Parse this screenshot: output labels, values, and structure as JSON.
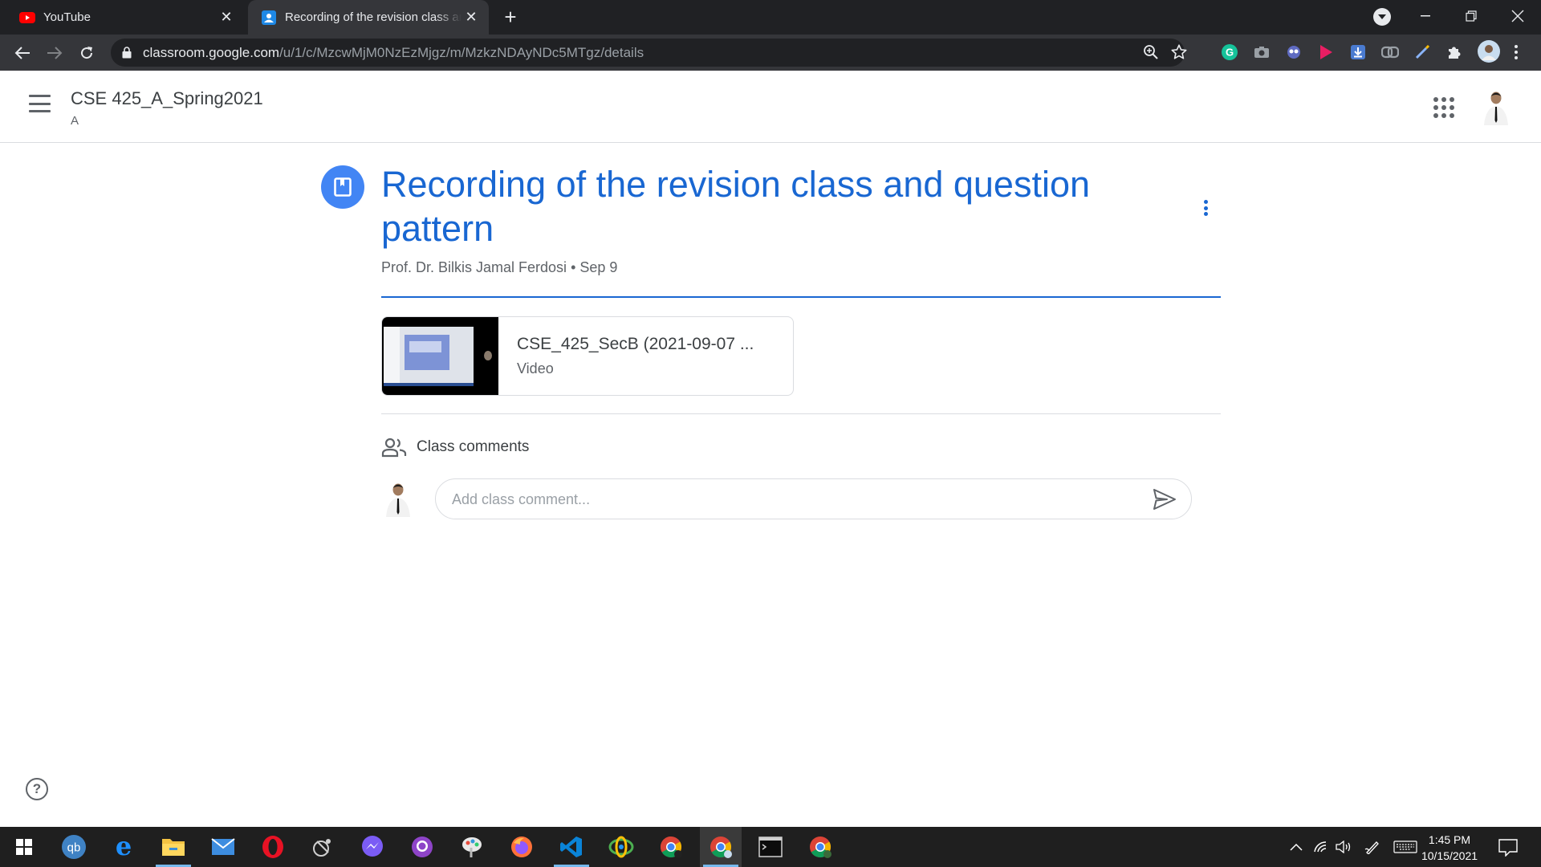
{
  "browser": {
    "tabs": [
      {
        "title": "YouTube",
        "icon": "youtube-icon",
        "active": false
      },
      {
        "title": "Recording of the revision class and question pattern",
        "icon": "classroom-icon",
        "active": true
      }
    ],
    "url_host": "classroom.google.com",
    "url_path": "/u/1/c/MzcwMjM0NzEzMjgz/m/MzkzNDAyNDc5MTgz/details",
    "extensions": [
      "grammarly-icon",
      "camera-icon",
      "extension-icon",
      "play-icon",
      "download-icon",
      "link-icon",
      "pen-icon",
      "puzzle-icon",
      "profile-avatar"
    ]
  },
  "header": {
    "class_title": "CSE 425_A_Spring2021",
    "class_section": "A"
  },
  "material": {
    "icon": "book-icon",
    "title": "Recording of the revision class and question pattern",
    "author": "Prof. Dr. Bilkis Jamal Ferdosi",
    "separator": "•",
    "date": "Sep 9",
    "attachment": {
      "title": "CSE_425_SecB (2021-09-07 ...",
      "type": "Video"
    }
  },
  "comments": {
    "heading": "Class comments",
    "placeholder": "Add class comment..."
  },
  "taskbar": {
    "time": "1:45 PM",
    "date": "10/15/2021"
  },
  "colors": {
    "accent": "#1967d2",
    "icon_bg": "#4285f4",
    "chrome_dark": "#202124",
    "chrome_toolbar": "#35363a",
    "taskbar": "#1f1f1f"
  }
}
